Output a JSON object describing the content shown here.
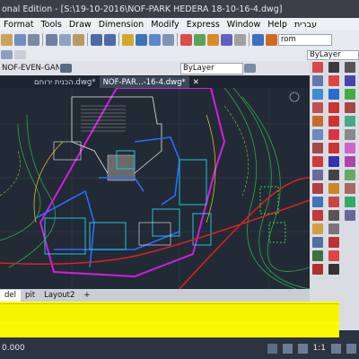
{
  "titlebar": {
    "title": "onal Edition - [S:\\19-10-2016\\NOF-PARK HEDERA 18-10-16-4.dwg]"
  },
  "menu": [
    "Format",
    "Tools",
    "Draw",
    "Dimension",
    "Modify",
    "Express",
    "Window",
    "Help",
    "עברית"
  ],
  "toolbar": {
    "layer_combo": "rom",
    "linetype_combo": "ByLayer",
    "layer_state": "ByLayer"
  },
  "toolbar3": {
    "current_layer": "NOF-EVEN-GAN"
  },
  "tabs": [
    {
      "label": "הכנית ירוחם.dwg*",
      "active": false
    },
    {
      "label": "NOF-PAR...-16-4.dwg*",
      "active": true
    }
  ],
  "layout_tabs": [
    "del",
    "pit",
    "Layout2",
    "+"
  ],
  "status": {
    "coords": "0.000",
    "scale": "1:1"
  },
  "colors": {
    "command_bg": "#fffe17",
    "canvas_bg": "#222a35",
    "accent": "#d21ee0"
  }
}
